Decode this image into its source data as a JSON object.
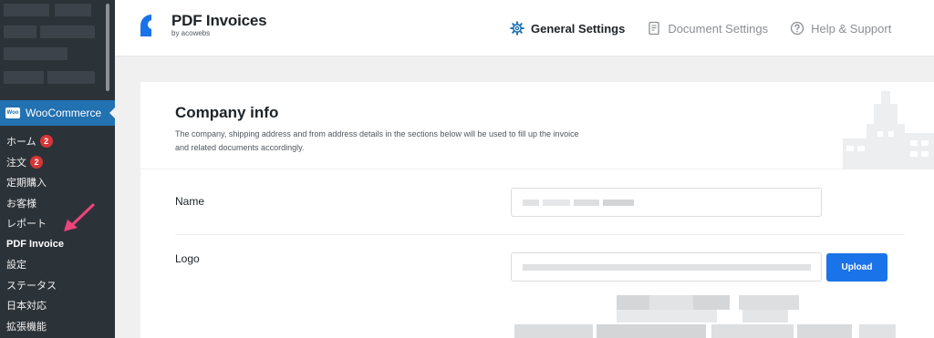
{
  "sidebar": {
    "woocommerce": {
      "label": "WooCommerce",
      "logo_text": "Woo"
    },
    "items": [
      {
        "label": "ホーム",
        "badge": "2"
      },
      {
        "label": "注文",
        "badge": "2"
      },
      {
        "label": "定期購入"
      },
      {
        "label": "お客様"
      },
      {
        "label": "レポート"
      },
      {
        "label": "PDF Invoice",
        "current": true
      },
      {
        "label": "設定"
      },
      {
        "label": "ステータス"
      },
      {
        "label": "日本対応"
      },
      {
        "label": "拡張機能"
      }
    ]
  },
  "header": {
    "brand_name": "PDF Invoices",
    "brand_by": "by acowebs",
    "nav": [
      {
        "label": "General Settings",
        "icon": "gear-icon",
        "active": true
      },
      {
        "label": "Document Settings",
        "icon": "document-icon",
        "active": false
      },
      {
        "label": "Help & Support",
        "icon": "question-circle-icon",
        "active": false
      }
    ]
  },
  "company_info": {
    "title": "Company info",
    "description": "The company, shipping address and from address details in the sections below will be used to fill up the invoice and related documents accordingly.",
    "name_label": "Name",
    "name_value": "",
    "logo_label": "Logo",
    "logo_value": "",
    "upload_label": "Upload"
  },
  "colors": {
    "sidebar_bg": "#1d2327",
    "active_menu": "#2271b1",
    "badge": "#d63638",
    "upload_button": "#1a73e8",
    "brand_blue": "#1a73e8",
    "annotation_arrow": "#f0437e"
  }
}
